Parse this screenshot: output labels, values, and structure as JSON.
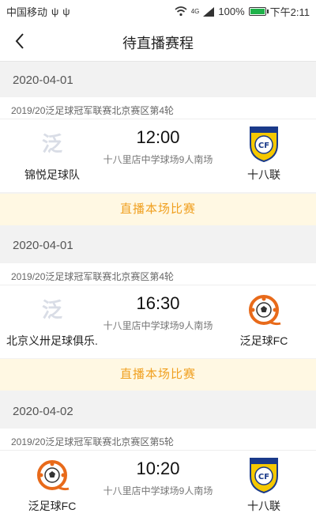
{
  "status_bar": {
    "carrier": "中国移动",
    "battery_percent": "100%",
    "time": "下午2:11",
    "network": "4G"
  },
  "header": {
    "title": "待直播赛程"
  },
  "matches": [
    {
      "date": "2020-04-01",
      "league": "2019/20泛足球冠军联赛北京赛区第4轮",
      "home_name": "锦悦足球队",
      "home_logo": "placeholder-logo",
      "time": "12:00",
      "venue": "十八里店中学球场9人南场",
      "away_name": "十八联",
      "away_logo": "villarreal-crest",
      "live_label": "直播本场比赛"
    },
    {
      "date": "2020-04-01",
      "league": "2019/20泛足球冠军联赛北京赛区第4轮",
      "home_name": "北京义卅足球俱乐.",
      "home_logo": "placeholder-logo",
      "time": "16:30",
      "venue": "十八里店中学球场9人南场",
      "away_name": "泛足球FC",
      "away_logo": "football-film-logo",
      "live_label": "直播本场比赛"
    },
    {
      "date": "2020-04-02",
      "league": "2019/20泛足球冠军联赛北京赛区第5轮",
      "home_name": "泛足球FC",
      "home_logo": "football-film-logo",
      "time": "10:20",
      "venue": "十八里店中学球场9人南场",
      "away_name": "十八联",
      "away_logo": "villarreal-crest"
    }
  ],
  "colors": {
    "accent": "#f0a020",
    "live_bg": "#fff8e3",
    "battery": "#1fb24a"
  }
}
